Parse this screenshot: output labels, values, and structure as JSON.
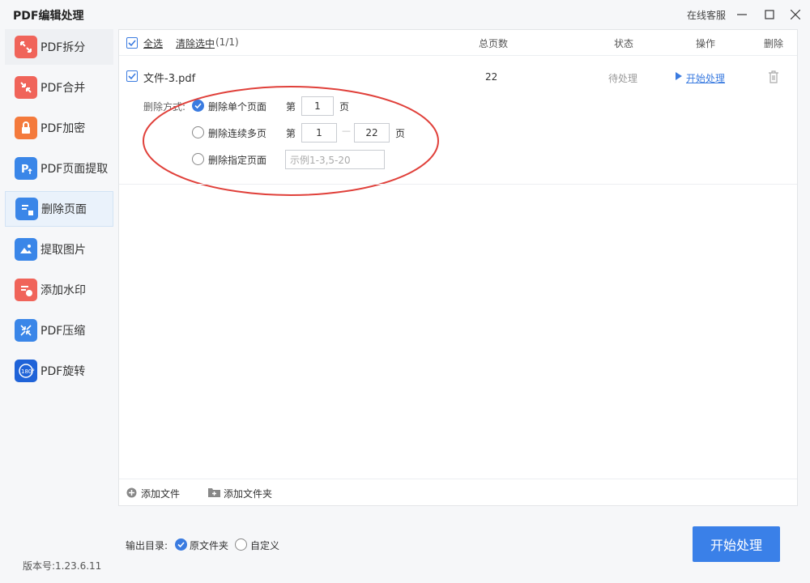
{
  "app": {
    "title": "PDF编辑处理",
    "service": "在线客服"
  },
  "sidebar": {
    "items": [
      {
        "label": "PDF拆分",
        "icon": "split-icon",
        "color": "#f0645a"
      },
      {
        "label": "PDF合并",
        "icon": "merge-icon",
        "color": "#f0645a"
      },
      {
        "label": "PDF加密",
        "icon": "lock-icon",
        "color": "#f47a3c"
      },
      {
        "label": "PDF页面提取",
        "icon": "page-extract-icon",
        "color": "#3a86e8"
      },
      {
        "label": "删除页面",
        "icon": "delete-page-icon",
        "color": "#3a86e8"
      },
      {
        "label": "提取图片",
        "icon": "image-extract-icon",
        "color": "#3a86e8"
      },
      {
        "label": "添加水印",
        "icon": "watermark-icon",
        "color": "#f0645a"
      },
      {
        "label": "PDF压缩",
        "icon": "compress-icon",
        "color": "#3a86e8"
      },
      {
        "label": "PDF旋转",
        "icon": "rotate-icon",
        "color": "#1f63d8"
      }
    ]
  },
  "table": {
    "select_all": "全选",
    "clear_selection": "清除选中",
    "selection_count": "(1/1)",
    "headers": {
      "pages": "总页数",
      "status": "状态",
      "action": "操作",
      "delete": "删除"
    }
  },
  "file": {
    "name": "文件-3.pdf",
    "pages": "22",
    "status": "待处理",
    "action": "开始处理"
  },
  "delete_options": {
    "label": "删除方式:",
    "single": "删除单个页面",
    "range": "删除连续多页",
    "specific": "删除指定页面",
    "page_prefix": "第",
    "page_suffix": "页",
    "single_value": "1",
    "range_from": "1",
    "range_to": "22",
    "range_sep": "—",
    "specific_placeholder": "示例1-3,5-20"
  },
  "footer": {
    "add_file": "添加文件",
    "add_folder": "添加文件夹"
  },
  "output": {
    "label": "输出目录:",
    "original": "原文件夹",
    "custom": "自定义"
  },
  "start_button": "开始处理",
  "version": "版本号:1.23.6.11",
  "colors": {
    "accent": "#3a80e8",
    "annotation": "#e0403a"
  }
}
